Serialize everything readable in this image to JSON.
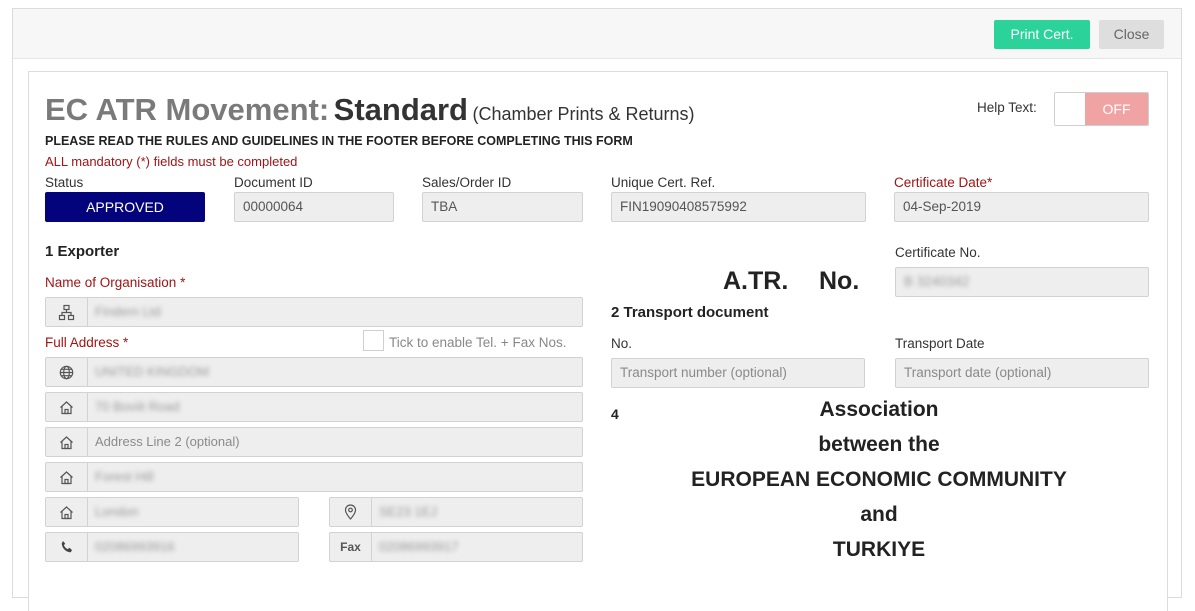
{
  "header": {
    "print_label": "Print Cert.",
    "close_label": "Close"
  },
  "form": {
    "title_main": "EC ATR Movement:",
    "title_type": "Standard",
    "title_sub": "(Chamber Prints & Returns)",
    "rules_notice": "PLEASE READ THE RULES AND GUIDELINES IN THE FOOTER BEFORE COMPLETING THIS FORM",
    "mandatory_notice": "ALL mandatory (*) fields must be completed",
    "help_text_label": "Help Text:",
    "help_toggle_state": "OFF"
  },
  "meta": {
    "status_label": "Status",
    "status_value": "APPROVED",
    "document_id_label": "Document ID",
    "document_id_value": "00000064",
    "sales_order_label": "Sales/Order ID",
    "sales_order_value": "TBA",
    "unique_ref_label": "Unique Cert. Ref.",
    "unique_ref_value": "FIN19090408575992",
    "cert_date_label": "Certificate Date*",
    "cert_date_value": "04-Sep-2019"
  },
  "exporter": {
    "heading": "1 Exporter",
    "org_label": "Name of Organisation *",
    "org_value": "Findern Ltd",
    "address_label": "Full Address *",
    "tick_label": "Tick to enable Tel. + Fax Nos.",
    "country": "UNITED KINGDOM",
    "address_line1": "70 Boviit Road",
    "address_line2_placeholder": "Address Line 2 (optional)",
    "address_line3": "Forest Hill",
    "city": "London",
    "postcode": "SE23 1EJ",
    "tel": "02086993916",
    "fax_addon": "Fax",
    "fax": "02086993917"
  },
  "certificate": {
    "cert_no_label": "Certificate No.",
    "cert_no_value": "B 3240342",
    "atr_label": "A.TR.",
    "no_label": "No."
  },
  "transport": {
    "heading": "2 Transport document",
    "no_label": "No.",
    "no_placeholder": "Transport number (optional)",
    "date_label": "Transport Date",
    "date_placeholder": "Transport date (optional)"
  },
  "association": {
    "number": "4",
    "line1": "Association",
    "line2": "between the",
    "line3": "EUROPEAN ECONOMIC COMMUNITY",
    "line4": "and",
    "line5": "TURKIYE"
  }
}
